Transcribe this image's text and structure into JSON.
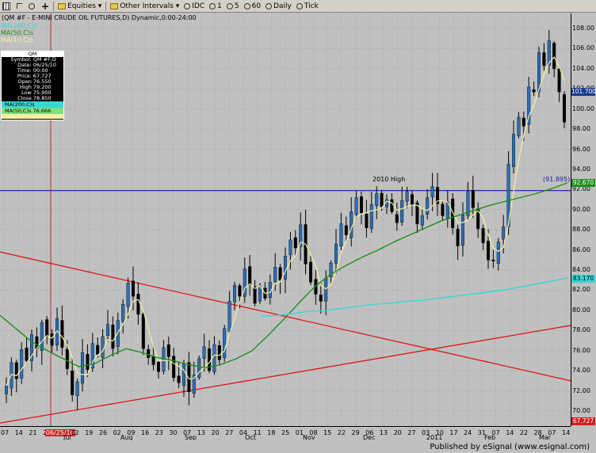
{
  "toolbar": {
    "items": [
      {
        "name": "chart-settings-icon",
        "label": ""
      },
      {
        "name": "crosshair-icon",
        "label": ""
      },
      {
        "name": "magnifier-icon",
        "label": ""
      },
      {
        "name": "add-icon",
        "label": ""
      },
      {
        "name": "equities-menu",
        "label": "Equities"
      },
      {
        "name": "other-intervals-menu",
        "label": "Other Intervals"
      },
      {
        "name": "idc-button",
        "label": "IDC"
      },
      {
        "name": "interval-1",
        "label": "1"
      },
      {
        "name": "interval-5",
        "label": "5"
      },
      {
        "name": "interval-60",
        "label": "60"
      },
      {
        "name": "interval-daily",
        "label": "Daily"
      },
      {
        "name": "interval-tick",
        "label": "Tick"
      }
    ]
  },
  "chart": {
    "title": "(QM #F - E-MINI CRUDE OIL FUTURES,D) Dynamic,0:00-24:00",
    "ma_labels": [
      {
        "text": "MA(200,C)s",
        "color": "#3ad6d6"
      },
      {
        "text": "MA(50,C)s",
        "color": "#1e8f1e"
      },
      {
        "text": "MA(10,C)s",
        "color": "#f4f0a0"
      }
    ],
    "cursor_date": "06/25/10",
    "annotation_2010_high": "2010 High",
    "annotation_level": "(91.895)",
    "info_box": {
      "header": "QM",
      "rows": [
        {
          "k": "Symbol:",
          "v": "QM #F,D"
        },
        {
          "k": "Date:",
          "v": "06/25/10"
        },
        {
          "k": "Time:",
          "v": "00:00"
        },
        {
          "k": "Price:",
          "v": "67.727"
        },
        {
          "k": "Open",
          "v": "76.550"
        },
        {
          "k": "High",
          "v": "79.200"
        },
        {
          "k": "Low",
          "v": "75.900"
        },
        {
          "k": "Close",
          "v": "78.850"
        }
      ],
      "ma200": "MA(200,C)s",
      "ma50": "MA(50,C)s 76.666"
    },
    "price_tags": [
      {
        "text": "101.700",
        "color": "#ffffff",
        "bg": "#1a3a8a",
        "price": 101.7
      },
      {
        "text": "92.670",
        "color": "#ffffff",
        "bg": "#1e8f1e",
        "price": 92.67
      },
      {
        "text": "83.170",
        "color": "#000000",
        "bg": "#3ad6d6",
        "price": 83.17
      },
      {
        "text": "67.727",
        "color": "#ffffff",
        "bg": "#d02020",
        "price": 67.727
      }
    ],
    "y_ticks": [
      "108.00",
      "106.00",
      "104.00",
      "102.00",
      "100.00",
      "98.00",
      "96.00",
      "94.00",
      "92.00",
      "90.00",
      "88.00",
      "86.00",
      "84.00",
      "82.00",
      "80.00",
      "78.00",
      "76.00",
      "74.00",
      "72.00",
      "70.00"
    ],
    "y_values": [
      108,
      106,
      104,
      102,
      100,
      98,
      96,
      94,
      92,
      90,
      88,
      86,
      84,
      82,
      80,
      78,
      76,
      74,
      72,
      70
    ],
    "x_days": [
      "07",
      "14",
      "21",
      "28",
      "06/25/10",
      "12",
      "19",
      "26",
      "02",
      "09",
      "16",
      "23",
      "30",
      "07",
      "13",
      "20",
      "27",
      "04",
      "11",
      "18",
      "25",
      "01",
      "08",
      "15",
      "22",
      "29",
      "06",
      "13",
      "20",
      "27",
      "03",
      "10",
      "17",
      "24",
      "31",
      "07",
      "14",
      "22",
      "28",
      "07",
      "14"
    ],
    "x_months": [
      "Jul",
      "Aug",
      "Sep",
      "Oct",
      "Nov",
      "Dec",
      "2011",
      "Feb",
      "Mar"
    ],
    "footer": "Published by eSignal (www.esignal.com)"
  },
  "chart_data": {
    "type": "candlestick",
    "title": "(QM #F - E-MINI CRUDE OIL FUTURES,D) Dynamic,0:00-24:00",
    "ylim": [
      68.5,
      109.5
    ],
    "series": [
      {
        "name": "QM #F",
        "close": [
          72.5,
          74.8,
          73.2,
          76.1,
          75.0,
          77.6,
          76.2,
          78.8,
          77.4,
          76.5,
          79.2,
          76.3,
          74.2,
          71.6,
          72.9,
          75.8,
          74.1,
          76.7,
          75.6,
          77.4,
          78.6,
          76.2,
          79.0,
          80.6,
          82.7,
          81.4,
          79.6,
          76.2,
          75.3,
          74.6,
          73.9,
          76.3,
          75.4,
          73.3,
          72.8,
          74.7,
          71.9,
          73.6,
          75.2,
          76.4,
          74.0,
          76.6,
          75.1,
          78.2,
          80.9,
          82.5,
          81.4,
          84.1,
          82.5,
          80.7,
          82.4,
          81.2,
          82.8,
          84.3,
          83.0,
          85.4,
          87.0,
          86.2,
          88.5,
          84.6,
          82.8,
          81.6,
          80.9,
          83.2,
          84.7,
          86.6,
          88.6,
          87.5,
          89.8,
          91.2,
          89.7,
          88.2,
          90.5,
          91.6,
          90.3,
          91.0,
          89.8,
          88.7,
          90.9,
          91.8,
          90.5,
          88.6,
          89.4,
          91.2,
          92.3,
          90.6,
          89.4,
          90.8,
          88.2,
          86.4,
          89.5,
          91.8,
          90.2,
          88.1,
          86.7,
          85.0,
          84.9,
          86.8,
          88.3,
          94.5,
          97.5,
          99.2,
          98.3,
          102.2,
          101.7,
          105.6,
          104.3,
          106.8,
          104.0,
          101.7,
          98.7
        ]
      },
      {
        "name": "MA(200,C)s",
        "color": "#3ad6d6"
      },
      {
        "name": "MA(50,C)s",
        "color": "#1e8f1e"
      },
      {
        "name": "MA(10,C)s",
        "color": "#f4f0a0"
      }
    ],
    "ma200_values": [
      79.4,
      79.5,
      79.7,
      79.9,
      80.0,
      80.2,
      80.4,
      80.6,
      80.7,
      80.9,
      81.0,
      81.2,
      81.4,
      81.6,
      81.8,
      82.0,
      82.3,
      82.6,
      82.9,
      83.2
    ],
    "ma50_values": [
      79.5,
      78.2,
      76.9,
      76.0,
      75.2,
      74.4,
      74.7,
      75.5,
      76.2,
      75.8,
      75.3,
      75.0,
      74.6,
      74.3,
      74.6,
      75.2,
      76.0,
      77.5,
      79.1,
      80.8,
      82.4,
      83.6,
      84.5,
      85.3,
      86.0,
      86.8,
      87.5,
      88.2,
      88.9,
      89.4,
      89.9,
      90.4,
      90.8,
      91.2,
      91.6,
      92.1,
      92.67
    ],
    "resistance_level": 91.895,
    "trendlines": [
      {
        "name": "downtrend",
        "color": "#e01818",
        "from": [
          0,
          85.8
        ],
        "to": [
          1,
          73.0
        ]
      },
      {
        "name": "uptrend",
        "color": "#e01818",
        "from": [
          0,
          68.8
        ],
        "to": [
          1,
          78.5
        ]
      }
    ],
    "xlabel": "",
    "ylabel": ""
  }
}
